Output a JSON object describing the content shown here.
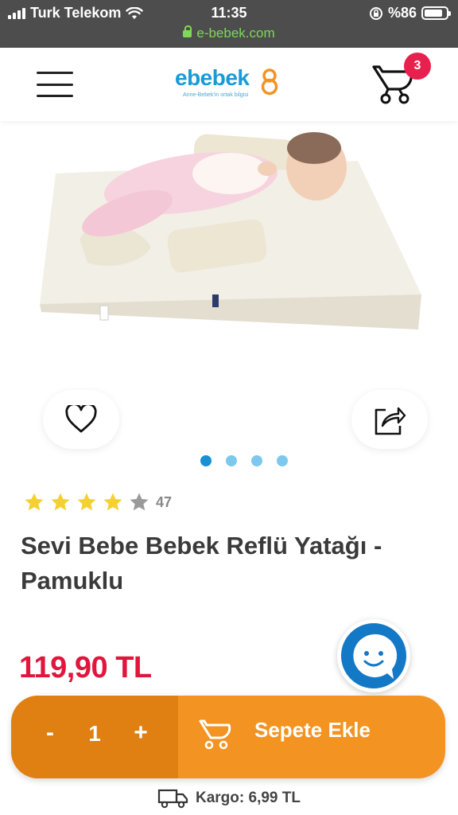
{
  "status_bar": {
    "carrier": "Turk Telekom",
    "time": "11:35",
    "battery_label": "%86",
    "battery_level": 0.86,
    "url": "e-bebek.com"
  },
  "header": {
    "logo_text": "ebebek",
    "logo_tagline": "Anne-Bebek'in ortak bilgisi",
    "cart_count": "3"
  },
  "product": {
    "rating": 4,
    "rating_max": 5,
    "review_count": "47",
    "title": "Sevi Bebe Bebek Reflü Yatağı - Pamuklu",
    "price": "119,90 TL",
    "image_count": 4,
    "active_image": 0
  },
  "purchase": {
    "minus_label": "-",
    "quantity": "1",
    "plus_label": "+",
    "add_to_cart_label": "Sepete Ekle"
  },
  "shipping": {
    "text": "Kargo: 6,99 TL"
  },
  "colors": {
    "brand_blue": "#1a9ad6",
    "badge_red": "#e8204e",
    "price_red": "#e2153c",
    "action_orange": "#f39322",
    "qty_orange": "#e07f12",
    "star_yellow": "#f5d033",
    "star_grey": "#9a9a9a"
  }
}
